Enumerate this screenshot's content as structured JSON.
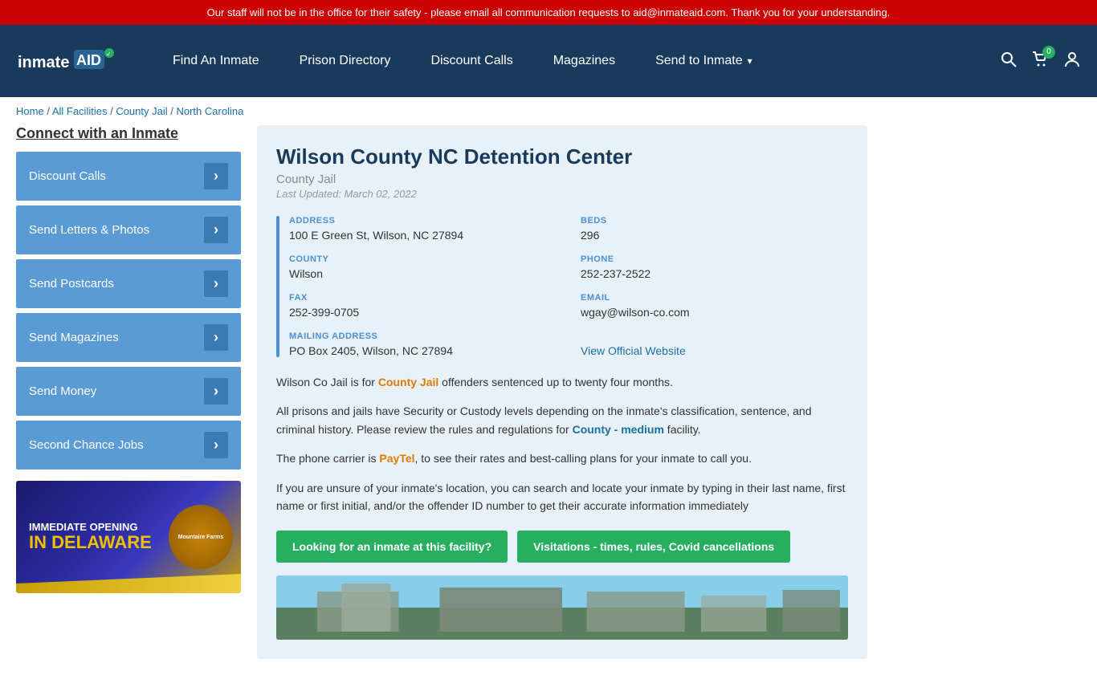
{
  "alert": {
    "text": "Our staff will not be in the office for their safety - please email all communication requests to aid@inmateaid.com. Thank you for your understanding."
  },
  "navbar": {
    "logo": "inmateAID",
    "links": [
      {
        "label": "Find An Inmate",
        "id": "find-an-inmate"
      },
      {
        "label": "Prison Directory",
        "id": "prison-directory"
      },
      {
        "label": "Discount Calls",
        "id": "discount-calls"
      },
      {
        "label": "Magazines",
        "id": "magazines"
      },
      {
        "label": "Send to Inmate",
        "id": "send-to-inmate",
        "dropdown": true
      }
    ],
    "cart_count": "0"
  },
  "breadcrumb": {
    "items": [
      "Home",
      "All Facilities",
      "County Jail",
      "North Carolina"
    ]
  },
  "sidebar": {
    "title": "Connect with an Inmate",
    "buttons": [
      {
        "label": "Discount Calls",
        "id": "discount-calls-btn"
      },
      {
        "label": "Send Letters & Photos",
        "id": "send-letters-btn"
      },
      {
        "label": "Send Postcards",
        "id": "send-postcards-btn"
      },
      {
        "label": "Send Magazines",
        "id": "send-magazines-btn"
      },
      {
        "label": "Send Money",
        "id": "send-money-btn"
      },
      {
        "label": "Second Chance Jobs",
        "id": "second-chance-jobs-btn"
      }
    ],
    "arrow_label": "›"
  },
  "ad": {
    "line1": "IMMEDIATE OPENING",
    "line2": "IN DELAWARE",
    "logo_text": "Mountaire Farms"
  },
  "facility": {
    "title": "Wilson County NC Detention Center",
    "type": "County Jail",
    "last_updated": "Last Updated: March 02, 2022",
    "address_label": "ADDRESS",
    "address_value": "100 E Green St, Wilson, NC 27894",
    "beds_label": "BEDS",
    "beds_value": "296",
    "county_label": "COUNTY",
    "county_value": "Wilson",
    "phone_label": "PHONE",
    "phone_value": "252-237-2522",
    "fax_label": "FAX",
    "fax_value": "252-399-0705",
    "email_label": "EMAIL",
    "email_value": "wgay@wilson-co.com",
    "mailing_label": "MAILING ADDRESS",
    "mailing_value": "PO Box 2405, Wilson, NC 27894",
    "website_label": "View Official Website",
    "desc1": "Wilson Co Jail is for County Jail offenders sentenced up to twenty four months.",
    "desc2": "All prisons and jails have Security or Custody levels depending on the inmate's classification, sentence, and criminal history. Please review the rules and regulations for County - medium facility.",
    "desc3": "The phone carrier is PayTel, to see their rates and best-calling plans for your inmate to call you.",
    "desc4": "If you are unsure of your inmate's location, you can search and locate your inmate by typing in their last name, first name or first initial, and/or the offender ID number to get their accurate information immediately",
    "btn1": "Looking for an inmate at this facility?",
    "btn2": "Visitations - times, rules, Covid cancellations"
  }
}
